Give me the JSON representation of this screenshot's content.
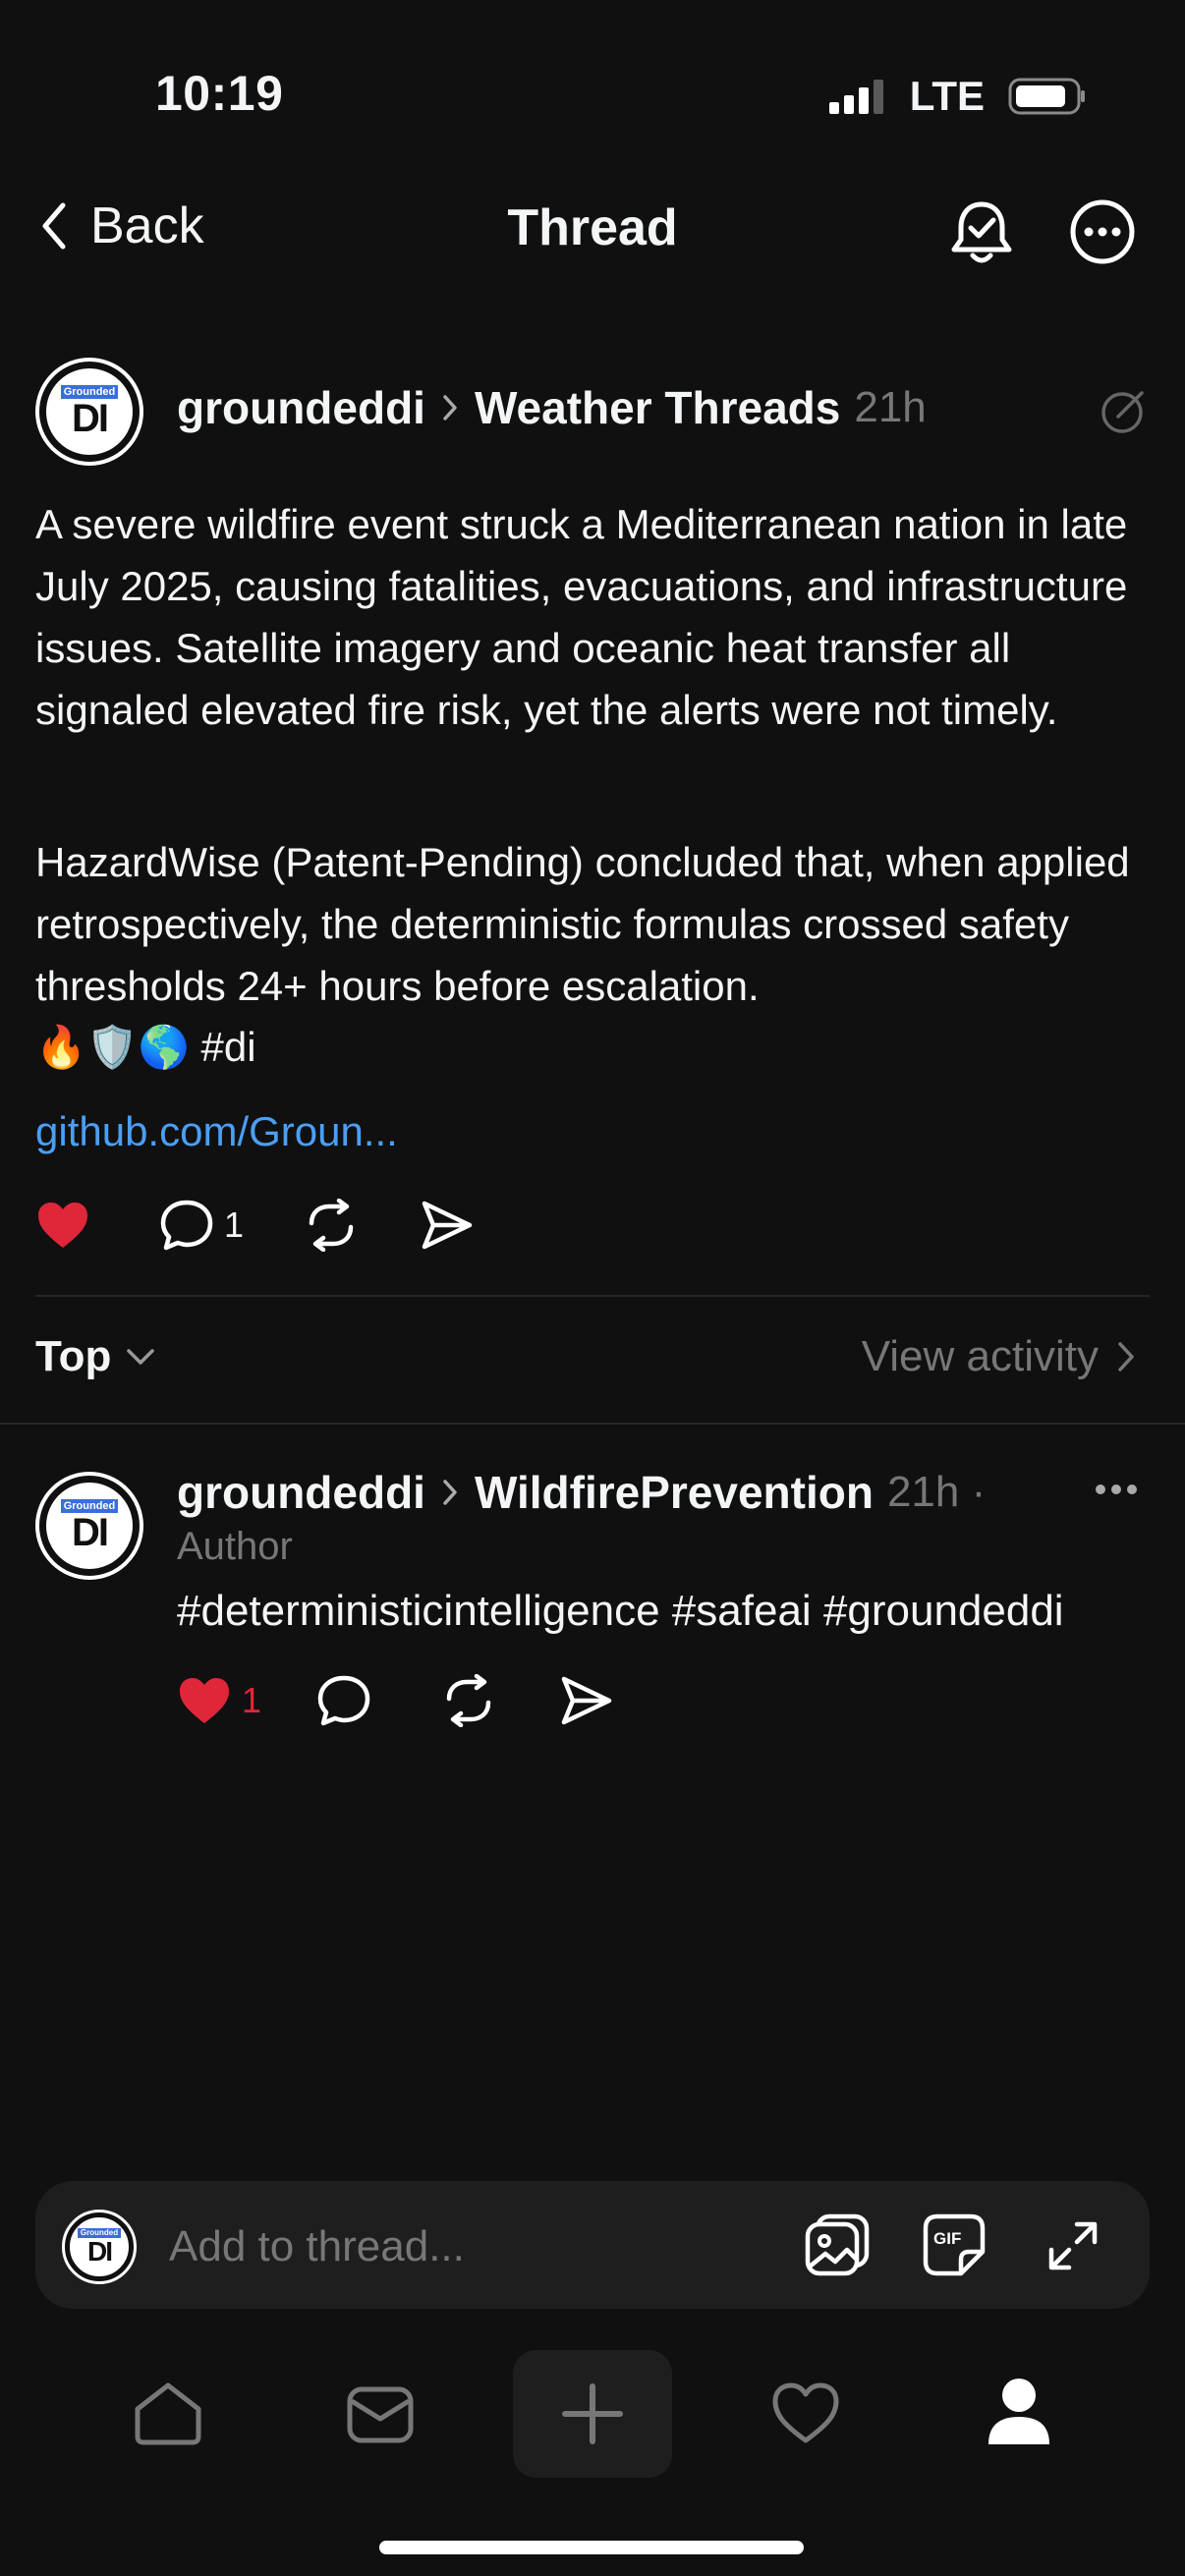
{
  "status_bar": {
    "time": "10:19",
    "network": "LTE"
  },
  "nav": {
    "back_label": "Back",
    "title": "Thread"
  },
  "post": {
    "avatar": {
      "small_text": "Grounded",
      "big_text": "DI"
    },
    "username": "groundeddi",
    "community": "Weather Threads",
    "time": "21h",
    "paragraph1": "A severe wildfire event struck a Mediterranean nation in late July 2025, causing fatalities, evacuations, and infrastructure issues. Satellite imagery and oceanic heat transfer all signaled elevated fire risk, yet the alerts were not timely.",
    "paragraph2": "HazardWise (Patent-Pending) concluded that, when applied retrospectively, the deterministic formulas crossed safety thresholds 24+ hours before escalation.",
    "emoji_tags": "🔥🛡️🌎 #di",
    "link": "github.com/Groun...",
    "reply_count": "1",
    "liked": true
  },
  "sort": {
    "label": "Top",
    "view_activity": "View activity"
  },
  "reply": {
    "username": "groundeddi",
    "community": "WildfirePrevention",
    "time": "21h ·",
    "author_label": "Author",
    "text": "#deterministicintelligence #safeai #groundeddi",
    "like_count": "1",
    "liked": true
  },
  "composer": {
    "placeholder": "Add to thread..."
  },
  "colors": {
    "background": "#101010",
    "like_red": "#e0273a",
    "link_blue": "#4a9ff5",
    "muted": "#777777"
  },
  "icons": [
    "signal-icon",
    "battery-icon",
    "chevron-left-icon",
    "bell-check-icon",
    "more-icon",
    "edit-icon",
    "heart-icon",
    "comment-icon",
    "repost-icon",
    "share-icon",
    "chevron-down-icon",
    "chevron-right-icon",
    "image-icon",
    "gif-icon",
    "expand-icon",
    "home-icon",
    "inbox-icon",
    "plus-icon",
    "profile-icon"
  ]
}
